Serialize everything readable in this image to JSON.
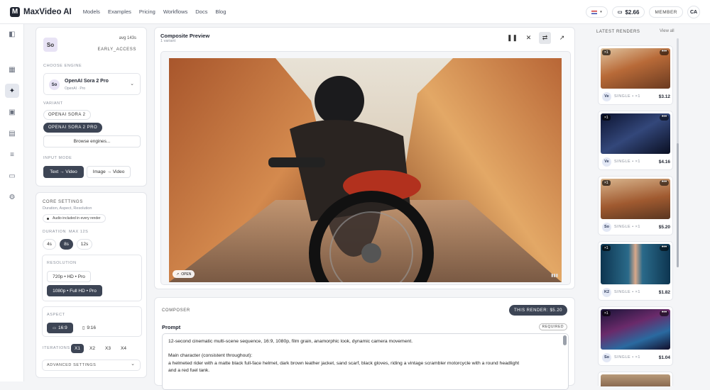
{
  "brand": {
    "name": "MaxVideo AI",
    "logo_letter": "M"
  },
  "nav": [
    "Models",
    "Examples",
    "Pricing",
    "Workflows",
    "Docs",
    "Blog"
  ],
  "topbar": {
    "wallet": "$2.66",
    "member": "MEMBER",
    "avatar": "CA"
  },
  "engine_panel": {
    "badge": "So",
    "avg": "avg 143s",
    "access": "EARLY_ACCESS",
    "choose_engine_label": "CHOOSE ENGINE",
    "engine_name": "OpenAI Sora 2 Pro",
    "engine_sub": "OpenAI · Pro",
    "engine_badge": "So",
    "variant_label": "VARIANT",
    "variants": [
      "OPENAI SORA 2",
      "OPENAI SORA 2 PRO"
    ],
    "browse": "Browse engines...",
    "input_mode_label": "INPUT MODE",
    "input_modes": [
      "Text → Video",
      "Image → Video"
    ]
  },
  "core": {
    "title": "CORE SETTINGS",
    "subtitle": "Duration, Aspect, Resolution",
    "audio": "Audio included in every render",
    "duration_label": "DURATION",
    "duration_max": "MAX 12S",
    "durations": [
      "4s",
      "8s",
      "12s"
    ],
    "resolution_label": "RESOLUTION",
    "resolutions": [
      "720p • HD • Pro",
      "1080p • Full HD • Pro"
    ],
    "aspect_label": "ASPECT",
    "aspects": [
      "16:9",
      "9:16"
    ],
    "iterations_label": "ITERATIONS",
    "iterations": [
      "X1",
      "X2",
      "X3",
      "X4"
    ],
    "advanced": "ADVANCED SETTINGS"
  },
  "preview": {
    "title": "Composite Preview",
    "subtitle": "1 variant",
    "open": "OPEN"
  },
  "composer": {
    "label": "COMPOSER",
    "cost": "THIS RENDER: $5.20",
    "prompt_label": "Prompt",
    "required": "REQUIRED",
    "prompt_line1": "12-second cinematic multi-scene sequence, 16:9, 1080p, film grain, anamorphic look, dynamic camera movement.",
    "prompt_line2": "Main character (consistent throughout):",
    "prompt_line3": "a helmeted rider with a matte black full-face helmet, dark brown leather jacket, sand scarf, black gloves, riding a vintage scrambler motorcycle with a round headlight",
    "prompt_line4": "and a red fuel tank."
  },
  "renders": {
    "title": "LATEST RENDERS",
    "view_all": "View all",
    "items": [
      {
        "tag": "×1",
        "badge": "Ve",
        "mode": "SINGLE • ×1",
        "price": "$3.12"
      },
      {
        "tag": "×1",
        "badge": "Ve",
        "mode": "SINGLE • ×1",
        "price": "$4.16"
      },
      {
        "tag": "×1",
        "badge": "So",
        "mode": "SINGLE • ×1",
        "price": "$5.20"
      },
      {
        "tag": "×1",
        "badge": "K2",
        "mode": "SINGLE • ×1",
        "price": "$1.82"
      },
      {
        "tag": "×1",
        "badge": "So",
        "mode": "SINGLE • ×1",
        "price": "$1.04"
      }
    ]
  }
}
